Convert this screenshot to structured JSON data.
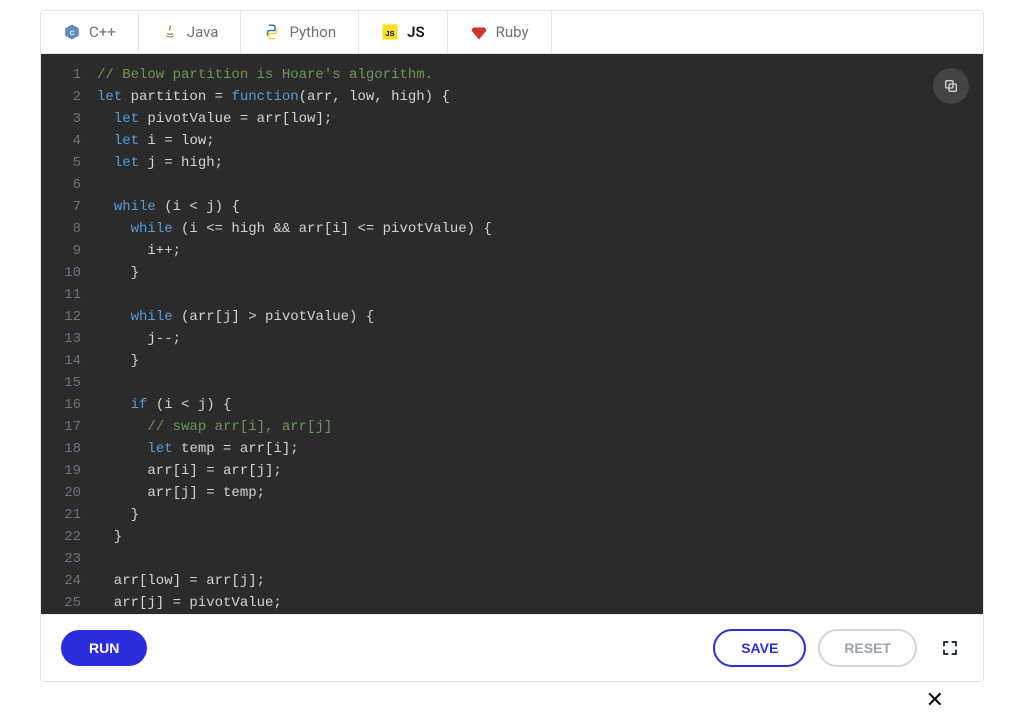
{
  "tabs": [
    {
      "label": "C++",
      "icon": "cpp-icon",
      "active": false
    },
    {
      "label": "Java",
      "icon": "java-icon",
      "active": false
    },
    {
      "label": "Python",
      "icon": "python-icon",
      "active": false
    },
    {
      "label": "JS",
      "icon": "js-icon",
      "active": true
    },
    {
      "label": "Ruby",
      "icon": "ruby-icon",
      "active": false
    }
  ],
  "buttons": {
    "run": "RUN",
    "save": "SAVE",
    "reset": "RESET"
  },
  "code_lines": [
    [
      {
        "t": "comment",
        "s": "// Below partition is Hoare's algorithm."
      }
    ],
    [
      {
        "t": "keyword",
        "s": "let"
      },
      {
        "t": "default",
        "s": " partition = "
      },
      {
        "t": "keyword",
        "s": "function"
      },
      {
        "t": "default",
        "s": "(arr, low, high) {"
      }
    ],
    [
      {
        "t": "default",
        "s": "  "
      },
      {
        "t": "keyword",
        "s": "let"
      },
      {
        "t": "default",
        "s": " pivotValue = arr[low];"
      }
    ],
    [
      {
        "t": "default",
        "s": "  "
      },
      {
        "t": "keyword",
        "s": "let"
      },
      {
        "t": "default",
        "s": " i = low;"
      }
    ],
    [
      {
        "t": "default",
        "s": "  "
      },
      {
        "t": "keyword",
        "s": "let"
      },
      {
        "t": "default",
        "s": " j = high;"
      }
    ],
    [
      {
        "t": "default",
        "s": ""
      }
    ],
    [
      {
        "t": "default",
        "s": "  "
      },
      {
        "t": "keyword",
        "s": "while"
      },
      {
        "t": "default",
        "s": " (i < j) {"
      }
    ],
    [
      {
        "t": "default",
        "s": "    "
      },
      {
        "t": "keyword",
        "s": "while"
      },
      {
        "t": "default",
        "s": " (i <= high && arr[i] <= pivotValue) {"
      }
    ],
    [
      {
        "t": "default",
        "s": "      i++;"
      }
    ],
    [
      {
        "t": "default",
        "s": "    }"
      }
    ],
    [
      {
        "t": "default",
        "s": ""
      }
    ],
    [
      {
        "t": "default",
        "s": "    "
      },
      {
        "t": "keyword",
        "s": "while"
      },
      {
        "t": "default",
        "s": " (arr[j] > pivotValue) {"
      }
    ],
    [
      {
        "t": "default",
        "s": "      j--;"
      }
    ],
    [
      {
        "t": "default",
        "s": "    }"
      }
    ],
    [
      {
        "t": "default",
        "s": ""
      }
    ],
    [
      {
        "t": "default",
        "s": "    "
      },
      {
        "t": "keyword",
        "s": "if"
      },
      {
        "t": "default",
        "s": " (i < j) {"
      }
    ],
    [
      {
        "t": "default",
        "s": "      "
      },
      {
        "t": "comment",
        "s": "// swap arr[i], arr[j]"
      }
    ],
    [
      {
        "t": "default",
        "s": "      "
      },
      {
        "t": "keyword",
        "s": "let"
      },
      {
        "t": "default",
        "s": " temp = arr[i];"
      }
    ],
    [
      {
        "t": "default",
        "s": "      arr[i] = arr[j];"
      }
    ],
    [
      {
        "t": "default",
        "s": "      arr[j] = temp;"
      }
    ],
    [
      {
        "t": "default",
        "s": "    }"
      }
    ],
    [
      {
        "t": "default",
        "s": "  }"
      }
    ],
    [
      {
        "t": "default",
        "s": ""
      }
    ],
    [
      {
        "t": "default",
        "s": "  arr[low] = arr[j];"
      }
    ],
    [
      {
        "t": "default",
        "s": "  arr[j] = pivotValue;"
      }
    ]
  ]
}
